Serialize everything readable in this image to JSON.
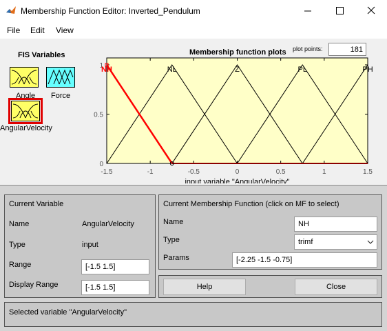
{
  "window": {
    "title": "Membership Function Editor: Inverted_Pendulum"
  },
  "menu": [
    "File",
    "Edit",
    "View"
  ],
  "fis": {
    "title": "FIS Variables",
    "vars": [
      {
        "label": "Angle",
        "kind": "input"
      },
      {
        "label": "Force",
        "kind": "output"
      },
      {
        "label": "AngularVelocity",
        "kind": "input",
        "selected": true
      }
    ]
  },
  "plot": {
    "title": "Membership function plots",
    "plot_points_label": "plot points:",
    "plot_points": "181"
  },
  "chart_data": {
    "type": "line",
    "xlabel": "input variable \"AngularVelocity\"",
    "xlim": [
      -1.5,
      1.5
    ],
    "ylim": [
      0,
      1
    ],
    "xticks": [
      "-1.5",
      "-1",
      "-0.5",
      "0",
      "0.5",
      "1",
      "1.5"
    ],
    "yticks": [
      "0",
      "0.5",
      "1"
    ],
    "series": [
      {
        "name": "NH",
        "x": [
          -2.25,
          -1.5,
          -0.75
        ],
        "y": [
          0,
          1,
          0
        ],
        "selected": true
      },
      {
        "name": "NL",
        "x": [
          -1.5,
          -0.75,
          0
        ],
        "y": [
          0,
          1,
          0
        ]
      },
      {
        "name": "Z",
        "x": [
          -0.75,
          0,
          0.75
        ],
        "y": [
          0,
          1,
          0
        ]
      },
      {
        "name": "PL",
        "x": [
          0,
          0.75,
          1.5
        ],
        "y": [
          0,
          1,
          0
        ]
      },
      {
        "name": "PH",
        "x": [
          0.75,
          1.5,
          2.25
        ],
        "y": [
          0,
          1,
          0
        ]
      }
    ],
    "colors": {
      "background": "#ffffc8",
      "line": "#000000",
      "selected": "#ff0000"
    }
  },
  "current_variable": {
    "header": "Current Variable",
    "name_label": "Name",
    "name_value": "AngularVelocity",
    "type_label": "Type",
    "type_value": "input",
    "range_label": "Range",
    "range_value": "[-1.5 1.5]",
    "display_range_label": "Display Range",
    "display_range_value": "[-1.5 1.5]"
  },
  "current_mf": {
    "header": "Current Membership Function (click on MF to select)",
    "name_label": "Name",
    "name_value": "NH",
    "type_label": "Type",
    "type_value": "trimf",
    "params_label": "Params",
    "params_value": "[-2.25 -1.5 -0.75]"
  },
  "buttons": {
    "help": "Help",
    "close": "Close"
  },
  "status": "Selected variable \"AngularVelocity\""
}
